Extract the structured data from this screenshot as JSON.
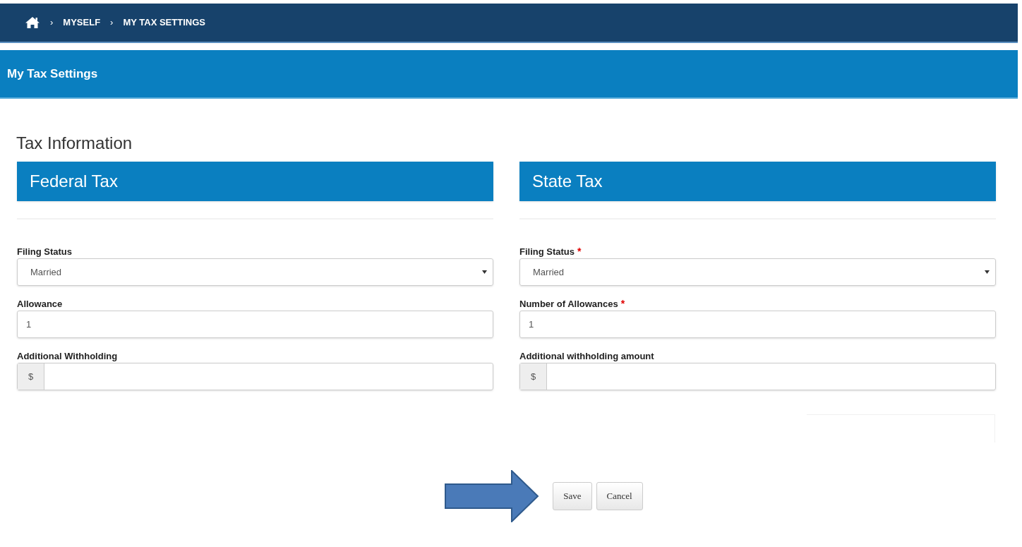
{
  "breadcrumb": {
    "items": [
      "MYSELF",
      "MY TAX SETTINGS"
    ],
    "separator": "›"
  },
  "page_title": "My Tax Settings",
  "section_title": "Tax Information",
  "panels": [
    {
      "title": "Federal Tax",
      "fields": [
        {
          "kind": "select",
          "label": "Filing Status",
          "required": false,
          "value": "Married"
        },
        {
          "kind": "text",
          "label": "Allowance",
          "required": false,
          "value": "1"
        },
        {
          "kind": "currency",
          "label": "Additional Withholding",
          "required": false,
          "prefix": "$"
        }
      ]
    },
    {
      "title": "State Tax",
      "fields": [
        {
          "kind": "select",
          "label": "Filing Status",
          "required": true,
          "value": "Married"
        },
        {
          "kind": "text",
          "label": "Number of Allowances",
          "required": true,
          "value": "1"
        },
        {
          "kind": "currency",
          "label": "Additional withholding amount",
          "required": false,
          "prefix": "$"
        }
      ]
    }
  ],
  "required_mark": "*",
  "buttons": [
    "Save",
    "Cancel"
  ]
}
